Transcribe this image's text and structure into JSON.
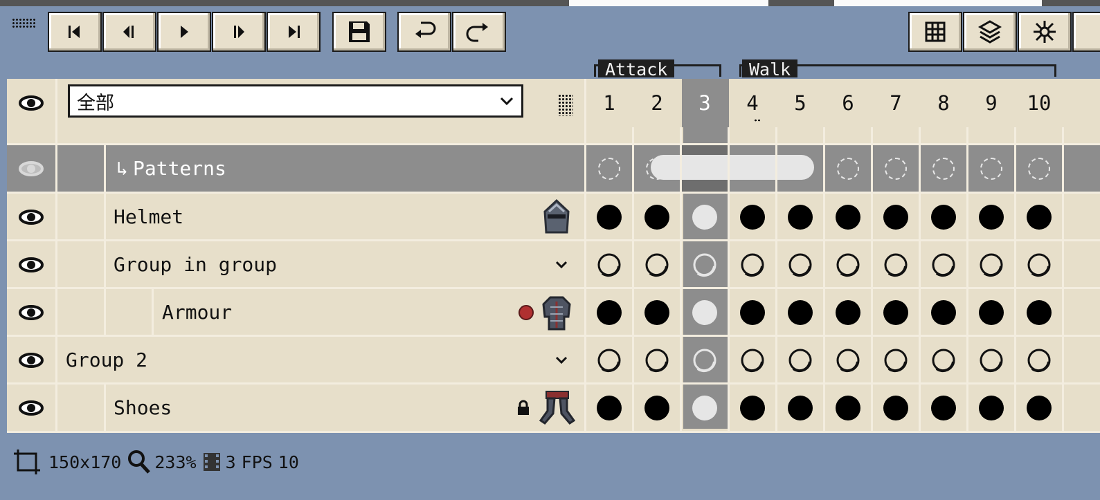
{
  "toolbar": {
    "buttons": [
      "first-frame",
      "previous-frame",
      "play",
      "next-frame",
      "last-frame",
      "save",
      "rewind",
      "redo"
    ],
    "right_buttons": [
      "grid",
      "onion-skin",
      "effects"
    ]
  },
  "layer_filter": {
    "selected": "全部"
  },
  "tags": [
    {
      "name": "Attack",
      "from": 1,
      "to": 3
    },
    {
      "name": "Walk",
      "from": 4,
      "to": 10
    }
  ],
  "frames": [
    "1",
    "2",
    "3",
    "4",
    "5",
    "6",
    "7",
    "8",
    "9",
    "10"
  ],
  "current_frame": 3,
  "layers": [
    {
      "name": "Patterns",
      "kind": "folder-linked",
      "selected": true
    },
    {
      "name": "Helmet",
      "kind": "layer",
      "indent": 1,
      "thumb": "helmet-thumbnail-icon"
    },
    {
      "name": "Group in group",
      "kind": "group",
      "indent": 1
    },
    {
      "name": "Armour",
      "kind": "layer",
      "indent": 2,
      "thumb": "armour-thumbnail-icon",
      "badge": "red-dot"
    },
    {
      "name": "Group 2",
      "kind": "group",
      "indent": 0
    },
    {
      "name": "Shoes",
      "kind": "layer",
      "indent": 1,
      "thumb": "shoes-thumbnail-icon",
      "locked": true
    }
  ],
  "status": {
    "canvas_size": "150x170",
    "zoom": "233%",
    "frame": "3",
    "fps_label": "FPS",
    "fps": "10"
  },
  "colors": {
    "background": "#7d92b0",
    "panel": "#e7dfca",
    "selected_row": "#8d8d8d",
    "tag": "#1f1f1f",
    "badge_red": "#b03030"
  }
}
